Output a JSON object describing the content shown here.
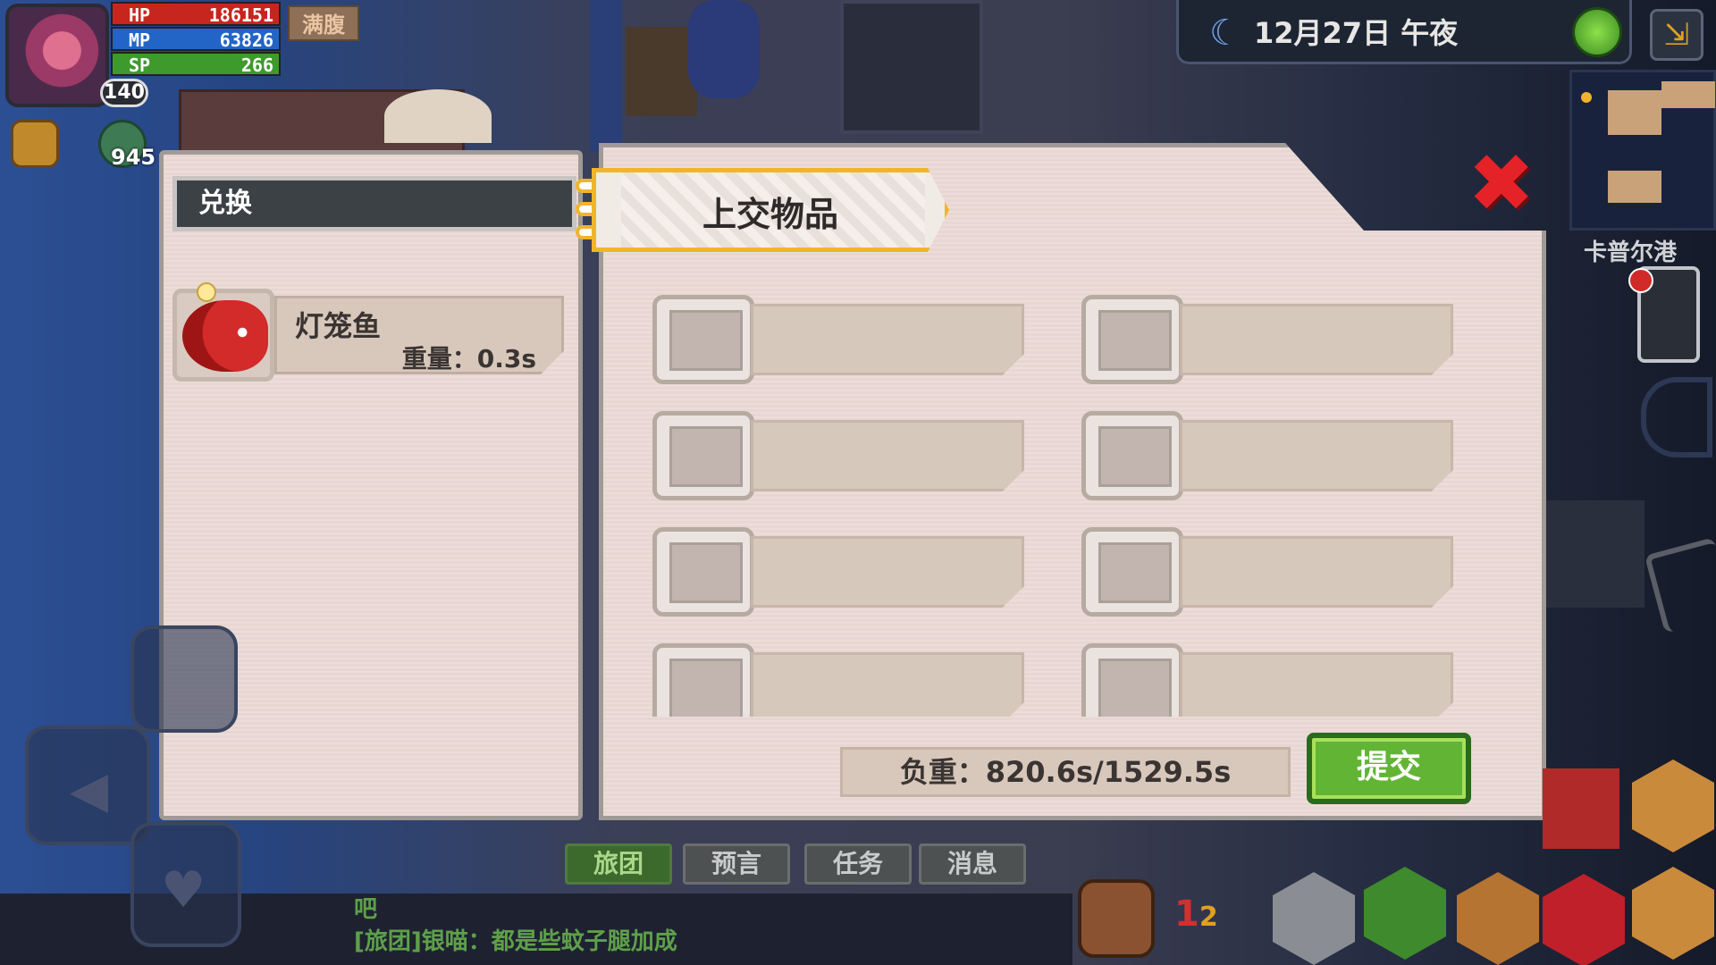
{
  "status": {
    "hp_label": "HP",
    "hp_value": "186151",
    "mp_label": "MP",
    "mp_value": "63826",
    "sp_label": "SP",
    "sp_value": "266",
    "level": "140",
    "satiety": "满腹",
    "quick_count": "945"
  },
  "top": {
    "date": "12月27日",
    "time_of_day": "午夜",
    "moon_icon": "crescent-moon-icon",
    "network_icon": "globe-icon",
    "exit_icon": "exit-icon"
  },
  "map": {
    "location": "卡普尔港"
  },
  "exchange_panel": {
    "tab_label": "兑换",
    "items": [
      {
        "name": "灯笼鱼",
        "weight": "重量：0.3s",
        "icon": "lantern-fish-icon"
      }
    ]
  },
  "submit_panel": {
    "title": "上交物品",
    "slot_count": 8,
    "load": "负重：820.6s/1529.5s",
    "submit_label": "提交",
    "close_icon": "close-icon"
  },
  "chat": {
    "tabs": [
      "旅团",
      "预言",
      "任务",
      "消息"
    ],
    "active_tab": "旅团",
    "lines": [
      "吧",
      "[旅团]银喵：都是些蚊子腿加成"
    ]
  },
  "hotbar": {
    "page_number": "1",
    "page_number_alt": "2"
  },
  "colors": {
    "hp": "#c7261f",
    "mp": "#2364c7",
    "sp": "#3e9a2c",
    "accent_gold": "#f0b52a",
    "submit_green": "#62b534",
    "close_red": "#e52228",
    "panel": "#e8d6d2"
  }
}
